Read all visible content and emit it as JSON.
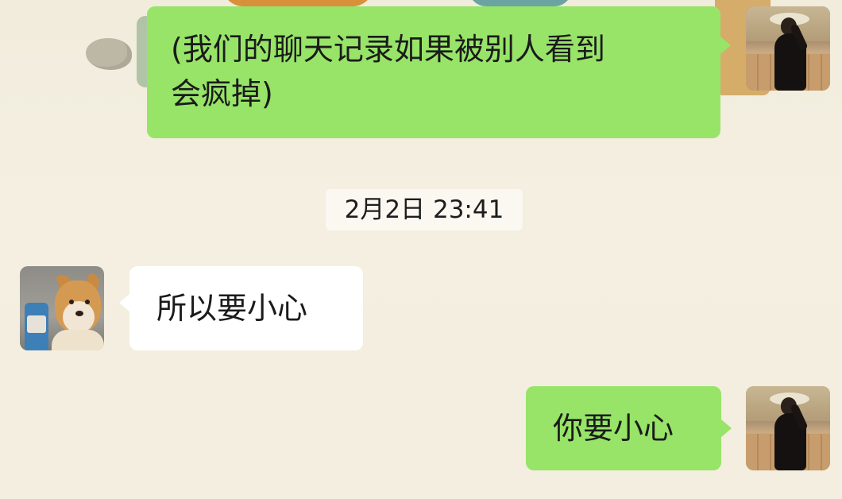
{
  "messages": [
    {
      "sender": "self",
      "text": "(我们的聊天记录如果被别人看到\n会疯掉)"
    },
    {
      "sender": "other",
      "text": "所以要小心"
    },
    {
      "sender": "self",
      "text": "你要小心"
    }
  ],
  "timestamp": "2月2日 23:41",
  "colors": {
    "sent_bubble": "#97e468",
    "received_bubble": "#ffffff",
    "chat_background": "#f3eedf"
  },
  "avatars": {
    "self": "woman-in-black-dress-avatar",
    "other": "shiba-dog-avatar"
  }
}
